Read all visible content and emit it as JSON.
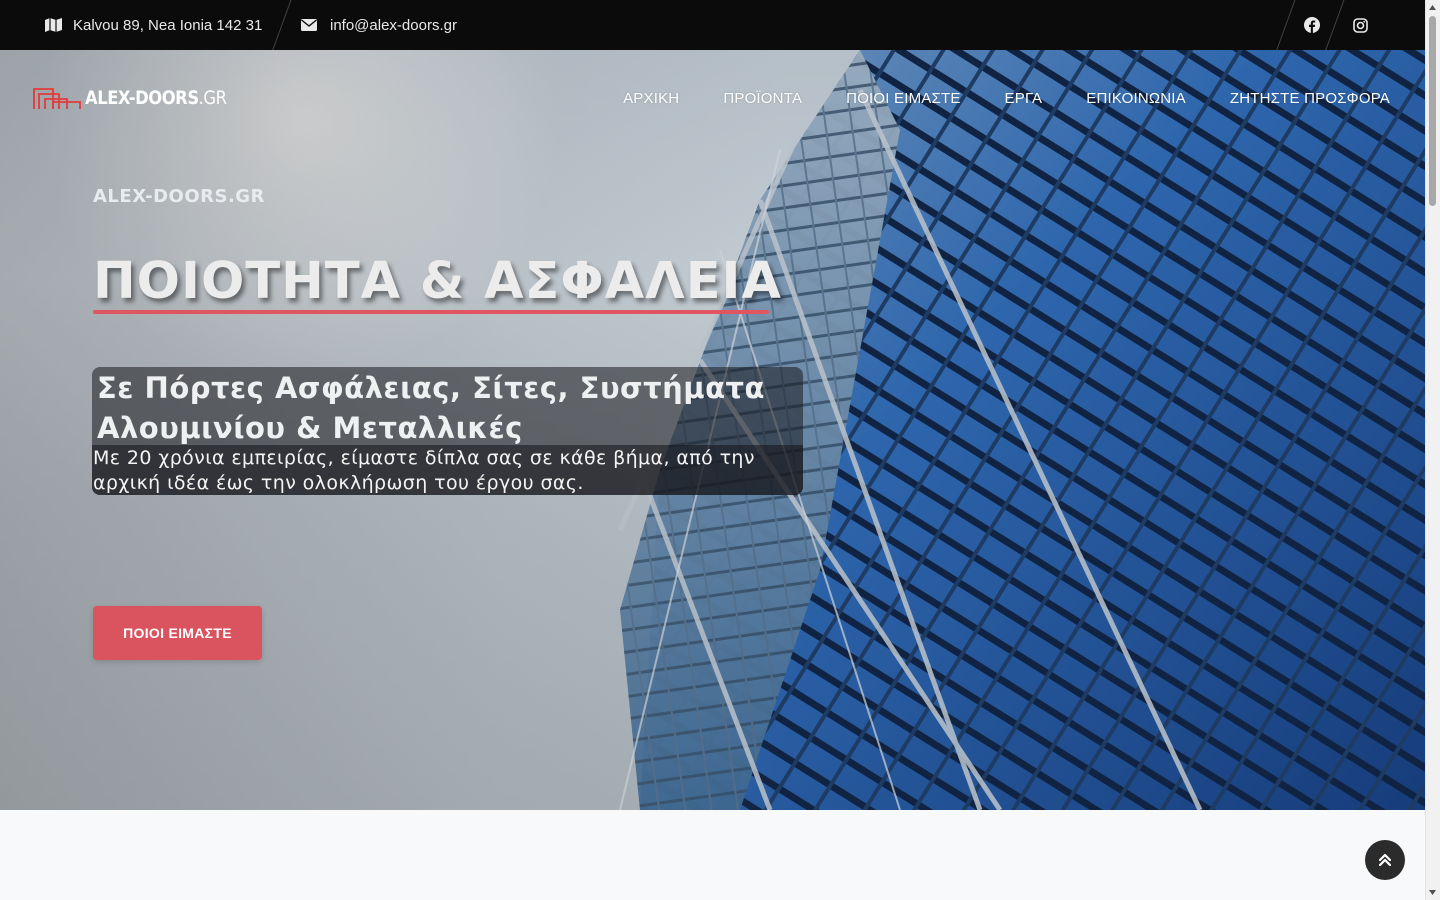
{
  "topbar": {
    "address": "Kalvou 89, Nea Ionia 142 31",
    "email": "info@alex-doors.gr",
    "social": [
      "facebook-icon",
      "instagram-icon"
    ]
  },
  "header": {
    "logo_main": "ALEX-DOORS",
    "logo_tld": ".GR",
    "nav": [
      {
        "label": "ΑΡΧΙΚΗ"
      },
      {
        "label": "ΠΡΟΪΟΝΤΑ"
      },
      {
        "label": "ΠΟΙΟΙ ΕΙΜΑΣΤΕ"
      },
      {
        "label": "ΕΡΓΑ"
      },
      {
        "label": "ΕΠΙΚΟΙΝΩΝΙΑ"
      },
      {
        "label": "ΖΗΤΗΣΤΕ ΠΡΟΣΦΟΡΑ"
      }
    ]
  },
  "hero": {
    "kicker": "ALEX-DOORS.GR",
    "headline": "ΠΟΙΟΤΗΤΑ & ΑΣΦΑΛΕΙΑ",
    "subtitle": "Σε Πόρτες Ασφάλειας, Σίτες, Συστήματα Αλουμινίου & Μεταλλικές",
    "description": "Με 20 χρόνια εμπειρίας, είμαστε δίπλα σας σε κάθε βήμα, από την αρχική ιδέα έως την ολοκλήρωση του έργου σας.",
    "cta_label": "ΠΟΙΟΙ ΕΙΜΑΣΤΕ"
  },
  "colors": {
    "accent": "#d9545e",
    "topbar_bg": "#0b0b0b",
    "glass_blue": "#2f6fc0"
  }
}
